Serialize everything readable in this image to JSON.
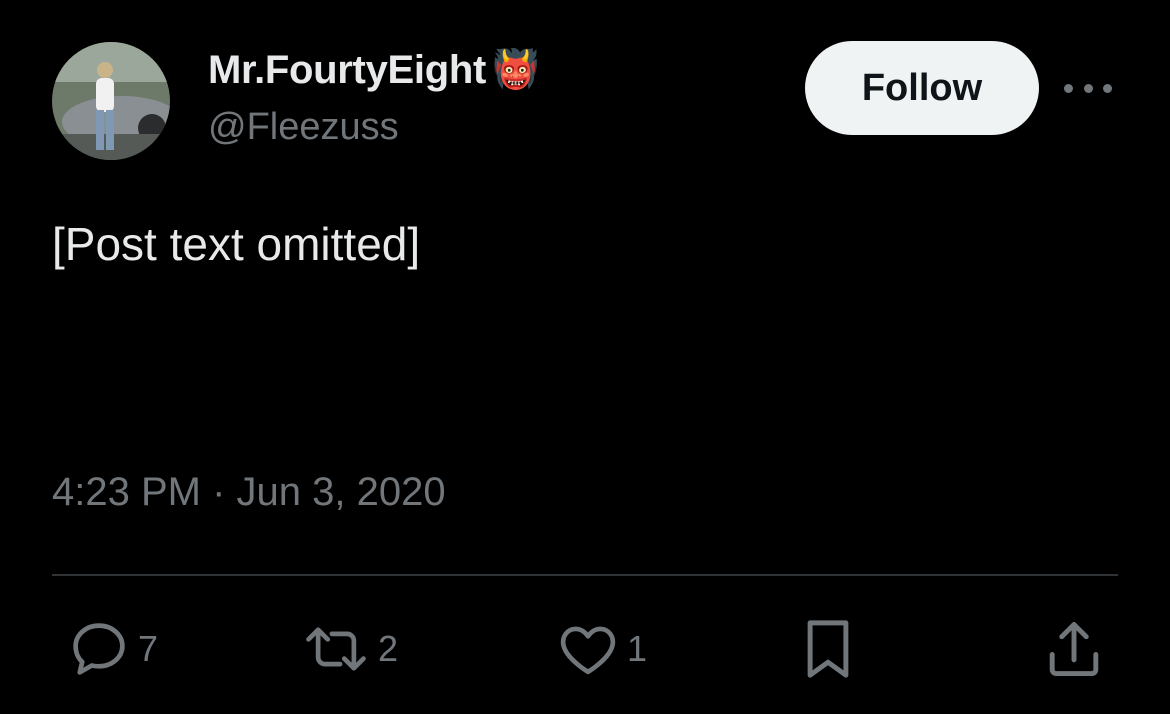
{
  "author": {
    "display_name": "Mr.FourtyEight",
    "badge_emoji": "👹",
    "handle": "@Fleezuss"
  },
  "header": {
    "follow_label": "Follow"
  },
  "post": {
    "text": "[Post text omitted]",
    "time": "4:23 PM",
    "separator": "·",
    "date": "Jun 3, 2020"
  },
  "actions": {
    "replies": "7",
    "reposts": "2",
    "likes": "1"
  },
  "colors": {
    "background": "#000000",
    "primary_text": "#e7e9ea",
    "secondary_text": "#71767b",
    "divider": "#2f3336",
    "follow_button_bg": "#eff3f4"
  },
  "icons": {
    "reply": "reply-icon",
    "repost": "repost-icon",
    "like": "heart-icon",
    "bookmark": "bookmark-icon",
    "share": "share-icon",
    "more": "more-icon"
  }
}
